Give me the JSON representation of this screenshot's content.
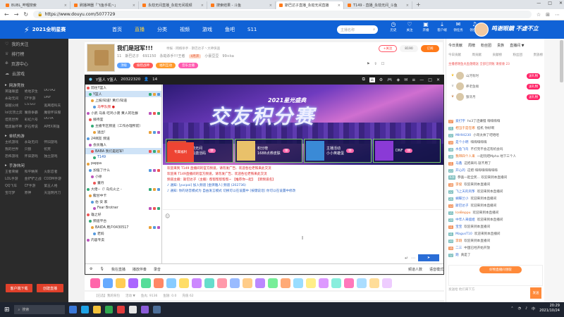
{
  "tabs": [
    {
      "label": "BUBL_哔哩搜索",
      "active": false
    },
    {
      "label": "刷播神器「飞鱼手机~」",
      "active": false
    },
    {
      "label": "永劫无间直播_永劫无间视频",
      "active": false
    },
    {
      "label": "搜索结果 - 斗鱼",
      "active": false
    },
    {
      "label": "斯巴达子直播_永劫无间直播",
      "active": true
    },
    {
      "label": "T149 - 直播_永劫无间_斗鱼",
      "active": false
    }
  ],
  "address": {
    "url": "https://www.douyu.com/5077729"
  },
  "header": {
    "brand": "2021全明星赛",
    "nav": [
      "首页",
      "直播",
      "分类",
      "视频",
      "游戏",
      "鱼吧",
      "S11"
    ],
    "nav_active": 1,
    "search_placeholder": "主播名称",
    "icons": [
      {
        "label": "历史",
        "icon": "clock-icon"
      },
      {
        "label": "关注",
        "icon": "heart-icon"
      },
      {
        "label": "开播",
        "icon": "camera-icon"
      },
      {
        "label": "客户端",
        "icon": "download-icon"
      },
      {
        "label": "领任务",
        "icon": "gift-icon"
      },
      {
        "label": "领任务",
        "icon": "bell-icon"
      }
    ],
    "promo": "鸣谢眼鏡 不虚不立"
  },
  "sidebar": {
    "top": [
      {
        "label": "我的关注",
        "icon": "heart-icon"
      },
      {
        "label": "排行榜",
        "icon": "trophy-icon"
      },
      {
        "label": "页游中心",
        "icon": "gamepad-icon"
      },
      {
        "label": "云游戏",
        "icon": "cloud-icon"
      }
    ],
    "sections": [
      {
        "title": "网游竞技",
        "items": [
          "英雄联盟",
          "绝地求生",
          "DOTA2",
          "永劫无间",
          "CF手游",
          "DNF",
          "穿越火线",
          "CS:GO",
          "逃离塔科夫",
          "lol云顶之弈",
          "魔兽争霸",
          "魔兽怀旧服",
          "坦克世界",
          "彩虹六号",
          "DOTA",
          "暗黑破坏神",
          "炉石传说",
          "APEX英雄"
        ]
      },
      {
        "title": "单机热游",
        "items": [
          "主机游戏",
          "永劫无间",
          "怀旧游戏",
          "我的世界",
          "只狼",
          "饥荒",
          "恐怖游戏",
          "怀旧游戏",
          "独立游戏"
        ]
      },
      {
        "title": "手游休闲",
        "items": [
          "王者荣耀",
          "和平精英",
          "火影忍者",
          "LOL手游",
          "金铲铲之战",
          "CODM手游",
          "QQ飞车",
          "CF手游",
          "第五人格",
          "宝可梦",
          "原神",
          "天涯明月刀"
        ]
      }
    ],
    "buttons": [
      "客户端下载",
      "创建直播"
    ]
  },
  "room": {
    "title": "我们是冠军!!!",
    "category": "永劫无间",
    "meta": "举报 · 网络杀手 · 斯巴达子丶大神侠盗",
    "line2": [
      "11",
      "斯巴达子",
      "691150",
      "永劫杀手!!!王者",
      "4月开",
      "小豪豆豆",
      "99+ka"
    ],
    "tags": [
      "顶级",
      "偷猎战神",
      "福利互动",
      "音乐主播"
    ],
    "follow": "+关注",
    "fans": "8190",
    "sub": "订阅"
  },
  "player": {
    "title": "Y篮人 Y篮人",
    "room_id": "20322320",
    "count": "14",
    "channels": [
      {
        "text": "前往Y篮人",
        "cls": ""
      },
      {
        "text": "Y篮人",
        "cls": "hl"
      },
      {
        "text": "上报/知道! 黄灯/知道",
        "cls": ""
      },
      {
        "text": "马甲队频 ●",
        "cls": "red"
      },
      {
        "text": "小武 马丢 吃鸡小弟  黄人的社群",
        "cls": ""
      },
      {
        "text": "接待室",
        "cls": ""
      },
      {
        "text": "主播专区频道（工作办理所前）",
        "cls": ""
      },
      {
        "text": "送出!",
        "cls": ""
      },
      {
        "text": "24啊友 频道",
        "cls": ""
      },
      {
        "text": "会员雅人",
        "cls": ""
      },
      {
        "text": "BABA 我们是冠军!",
        "cls": "hl"
      },
      {
        "text": "T149",
        "cls": "blue"
      },
      {
        "text": "pappa",
        "cls": ""
      },
      {
        "text": "加强了什么",
        "cls": ""
      },
      {
        "text": "小徐",
        "cls": ""
      },
      {
        "text": "董丹",
        "cls": ""
      },
      {
        "text": "大佬--（! 乌托火之 -",
        "cls": ""
      },
      {
        "text": "龍甘中卡",
        "cls": ""
      },
      {
        "text": "伯 安 家",
        "cls": ""
      },
      {
        "text": "Fear Brotner",
        "cls": ""
      },
      {
        "text": "雄之好",
        "cls": ""
      },
      {
        "text": "频道平台",
        "cls": ""
      },
      {
        "text": "BAIDA 用户0430517",
        "cls": ""
      },
      {
        "text": "老妈",
        "cls": ""
      },
      {
        "text": "内容专卖",
        "cls": ""
      }
    ],
    "banner_title": "交友积分赛",
    "banner_sub": "2021星光盛典",
    "cards": [
      {
        "badge": "永劫无间",
        "text": "终极激活码",
        "btn": "领"
      },
      {
        "badge": "积分榜",
        "text": "1688点券皮肤",
        "btn": "领"
      },
      {
        "badge": "主播活动",
        "text": "小小英雄蛋",
        "btn": "领"
      },
      {
        "badge": "DNF",
        "text": "",
        "btn": "领"
      }
    ],
    "banner_badge": "专属福利",
    "chat": [
      {
        "cls": "r",
        "text": "欢迎来到 T149 直播间的官方频道，请勿发广告、欢迎各位老铁来此交流"
      },
      {
        "cls": "r",
        "text": "欢迎来 T149直播间的官方频道，请勿发广告、欢迎各位老铁来此交流"
      },
      {
        "cls": "r",
        "text": "频道主播：斯巴达子（主播）帮帮帮帮帮帮~ 【推荐你一起】  【新频道名】"
      },
      {
        "cls": "b",
        "text": "♪ 通知:  [yucpoi] 加入频道  [金牌雅人] 频道 (202736)"
      },
      {
        "cls": "b",
        "text": "♪ 通知:  你的语音模式为  自由发言模式  切换可以在设置中  [按键说话] 你可以在设置中修改"
      }
    ],
    "toolbar": [
      "我在直播",
      "播放伴奏",
      "录音"
    ],
    "bottom": [
      "频道人数",
      "语音模式"
    ]
  },
  "gifts": {
    "footer": [
      "【已选】我的背包",
      "活动 ▼",
      "鱼丸: 9136",
      "鱼翅: 0.0",
      "充值 62"
    ]
  },
  "right": {
    "tabs": [
      "今日贡献",
      "周榜",
      "粉丝团",
      "贵族",
      "直播间 ▼"
    ],
    "subtabs": [
      "今日贡献",
      "周贡献",
      "贡献榜",
      "粉丝团",
      "贵族榜"
    ],
    "notice": "主播感谢鱼丸鱼翅赠送 全部已到账 请接收 23",
    "ranks": [
      {
        "name": "山河有时",
        "btn": "送礼物"
      },
      {
        "name": "养老鱼摊",
        "btn": "送礼物"
      },
      {
        "name": "狼牙月",
        "btn": "送礼物"
      }
    ],
    "danmu": [
      {
        "lv": "17",
        "user": "爱打字",
        "msg": "hs3了还嫌慢 嗨嗨嗨嗨"
      },
      {
        "lv": "21",
        "user": "相当于是在哪",
        "msg": "挂机 你好啊"
      },
      {
        "lv": "22",
        "user": "MH94230",
        "msg": "小哥太帅了吧哈哈"
      },
      {
        "lv": "14",
        "user": "是个小明",
        "msg": "嗨嗨嗨嗨嗨"
      },
      {
        "lv": "16",
        "user": "水鱼飞鸟",
        "msg": "不打完不会这有机会吗"
      },
      {
        "lv": "38",
        "user": "我带四个人来",
        "msg": "一起玩吧Mpha 地下三个人"
      },
      {
        "lv": "11",
        "user": "马鑫",
        "msg": "这把来吗 就不用了"
      },
      {
        "lv": "23",
        "user": "开心的",
        "msg": "这把 嗨嗨嗨嗨嗨嗨嗨"
      },
      {
        "lv": "系统",
        "user": "",
        "msg": "恭喜一起全民... 欢迎来到本直播间"
      },
      {
        "lv": "18",
        "user": "李俊",
        "msg": "欢迎来到本直播间"
      },
      {
        "lv": "22",
        "user": "飞上天的风筝",
        "msg": "欢迎来到本直播间"
      },
      {
        "lv": "26",
        "user": "蝴蝶兰小",
        "msg": "欢迎来到本直播间"
      },
      {
        "lv": "13",
        "user": "斯巴达子",
        "msg": "欢迎来到本直播间"
      },
      {
        "lv": "15",
        "user": "IceBeppu",
        "msg": "欢迎来到本直播间"
      },
      {
        "lv": "29",
        "user": "中年人来摆姐",
        "msg": "欢迎来到本直播间"
      },
      {
        "lv": "11",
        "user": "宝宝",
        "msg": "欢迎来到本直播间"
      },
      {
        "lv": "31",
        "user": "MagusT10",
        "msg": "欢迎来到本直播间"
      },
      {
        "lv": "20",
        "user": "李翔",
        "msg": "欢迎来到本直播间"
      },
      {
        "lv": "16",
        "user": "二三",
        "msg": "中国已经开始开放"
      },
      {
        "lv": "12",
        "user": "跑",
        "msg": "真是了"
      }
    ],
    "promo": "好物直播间领取",
    "lower": "发送给 他们来下方",
    "send": "发送"
  },
  "taskbar": {
    "search": "搜索",
    "time": "20:29",
    "date": "2021/10/24"
  }
}
